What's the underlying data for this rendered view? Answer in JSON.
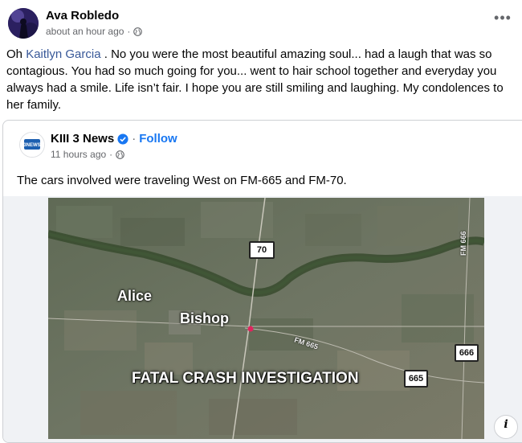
{
  "post": {
    "author": "Ava Robledo",
    "time": "about an hour ago",
    "text_before": "Oh ",
    "mention": "Kaitlyn Garcia",
    "text_after": " . No you were the most beautiful amazing soul... had a laugh that was so contagious. You had so much going for you... went to hair school together and everyday you always had a smile. Life isn’t fair. I hope you are still smiling and laughing. My condolences to her family.",
    "more_label": "•••"
  },
  "shared": {
    "page_name": "KIII 3 News",
    "separator": "·",
    "follow_label": "Follow",
    "time": "11 hours ago",
    "logo_text": "3NEWS",
    "text": "The cars involved were traveling West on FM-665 and FM-70."
  },
  "map": {
    "label_alice": "Alice",
    "label_bishop": "Bishop",
    "sign_70": "70",
    "sign_665": "665",
    "sign_666": "666",
    "road_fm665": "FM 665",
    "road_fm666": "FM 666",
    "banner": "FATAL CRASH INVESTIGATION",
    "crash_color": "#e0245e"
  },
  "info_label": "i",
  "colors": {
    "link": "#385898",
    "follow": "#1877f2",
    "meta": "#65676b"
  }
}
